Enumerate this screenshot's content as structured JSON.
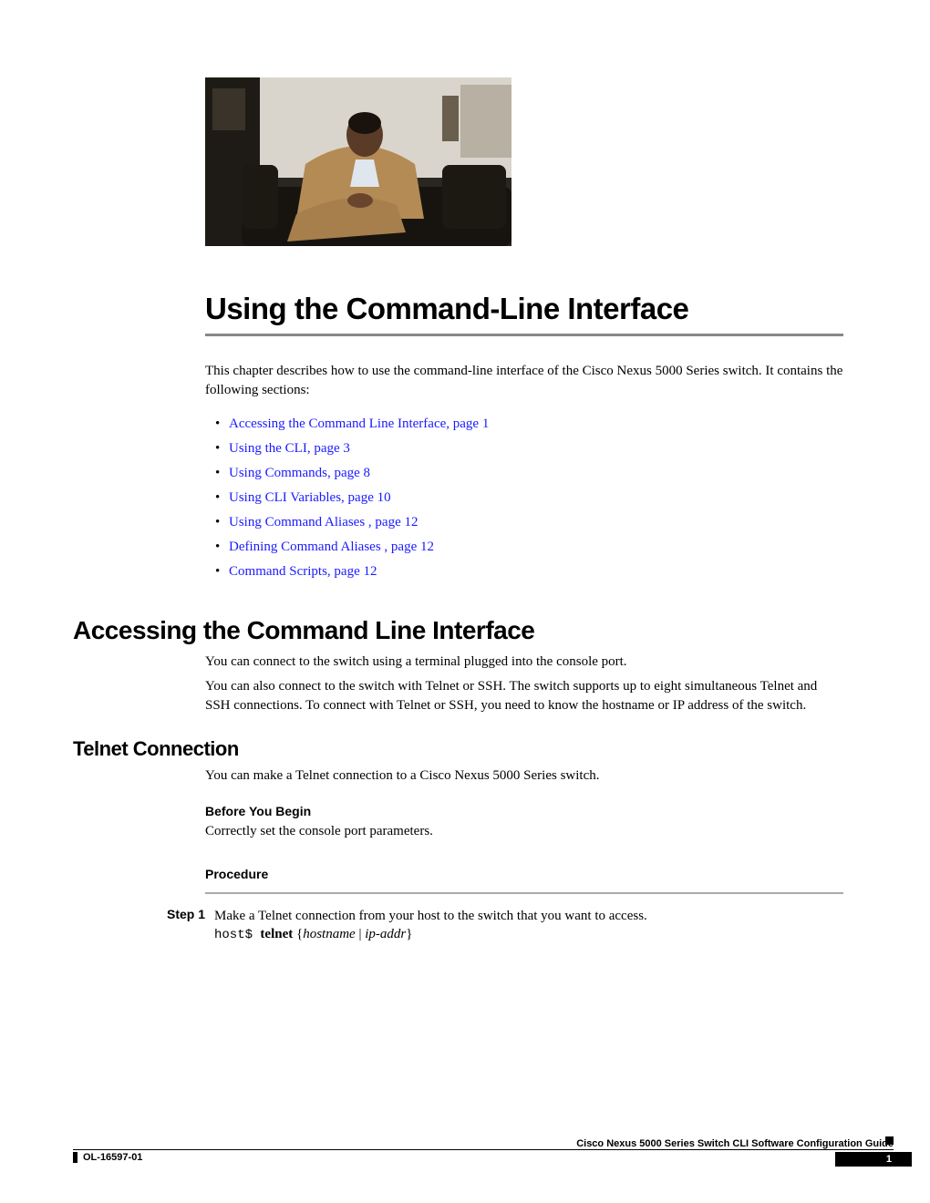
{
  "chapter": {
    "title": "Using the Command-Line Interface",
    "intro": "This chapter describes how to use the command-line interface of the Cisco Nexus 5000 Series switch. It contains the following sections:"
  },
  "toc": [
    {
      "text": "Accessing the Command Line Interface,  page  1"
    },
    {
      "text": "Using the CLI,  page  3"
    },
    {
      "text": "Using Commands,  page  8"
    },
    {
      "text": "Using CLI Variables,  page  10"
    },
    {
      "text": "Using Command Aliases ,  page  12"
    },
    {
      "text": "Defining Command Aliases ,  page  12"
    },
    {
      "text": "Command Scripts,  page  12"
    }
  ],
  "section1": {
    "heading": "Accessing the Command Line Interface",
    "p1": "You can connect to the switch using a terminal plugged into the console port.",
    "p2": "You can also connect to the switch with Telnet or SSH. The switch supports up to eight simultaneous Telnet and SSH connections. To connect with Telnet or SSH, you need to know the hostname or IP address of the switch."
  },
  "telnet": {
    "heading": "Telnet Connection",
    "p1": "You can make a Telnet connection to a Cisco Nexus 5000 Series switch.",
    "before_heading": "Before You Begin",
    "before_text": "Correctly set the console port parameters.",
    "procedure_heading": "Procedure",
    "step1_label": "Step 1",
    "step1_text": "Make a Telnet connection from your host to the switch that you want to access.",
    "step1_cmd_prompt": "host$ ",
    "step1_cmd_bold": "telnet",
    "step1_cmd_brace_open": " {",
    "step1_cmd_arg1": "hostname",
    "step1_cmd_pipe": "  |  ",
    "step1_cmd_arg2": "ip-addr",
    "step1_cmd_brace_close": "}"
  },
  "footer": {
    "guide_title": "Cisco Nexus 5000 Series Switch CLI Software Configuration Guide",
    "doc_id": "OL-16597-01",
    "page_number": "1"
  }
}
